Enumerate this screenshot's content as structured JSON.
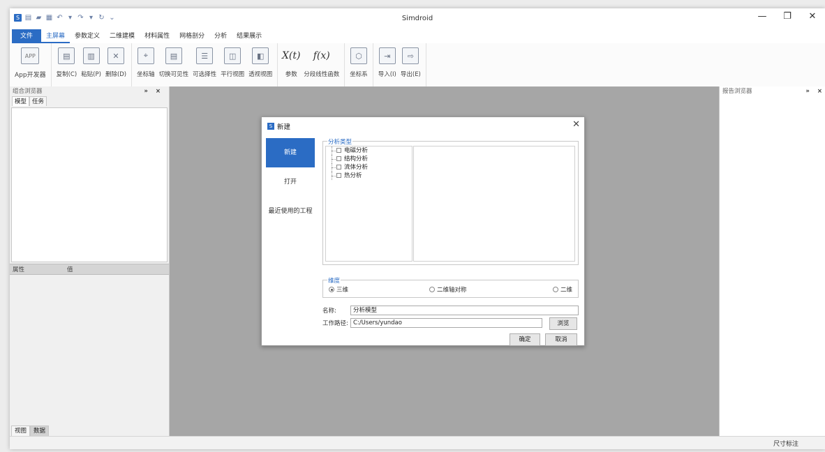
{
  "app": {
    "title": "Simdroid"
  },
  "window_controls": {
    "minimize": "—",
    "restore": "❐",
    "close": "✕"
  },
  "quick_access": [
    "save-icon",
    "open-folder-icon",
    "save-disk-icon",
    "undo-icon",
    "redo-icon",
    "refresh-icon"
  ],
  "menus": [
    "文件",
    "主屏幕",
    "参数定义",
    "二维建模",
    "材料属性",
    "网格剖分",
    "分析",
    "结果展示"
  ],
  "active_menu": "主屏幕",
  "ribbon": {
    "app_dev": {
      "icon": "APP",
      "label": "App开发器"
    },
    "copy": "复制(C)",
    "paste": "粘贴(P)",
    "delete": "删除(D)",
    "axis": "坐标轴",
    "toggle_visibility": "切换可见性",
    "selectability": "可选择性",
    "parallel_view": "平行视图",
    "perspective_view": "透视视图",
    "param_icon": "X(t)",
    "param": "参数",
    "piecewise_icon": "f(x)",
    "piecewise": "分段线性函数",
    "coord_system": "坐标系",
    "import": "导入(I)",
    "export": "导出(E)"
  },
  "left_panel": {
    "title": "组合浏览器",
    "tabs": [
      "模型",
      "任务"
    ],
    "prop_headers": {
      "property": "属性",
      "value": "值"
    },
    "bottom_tabs": [
      "视图",
      "数据"
    ]
  },
  "right_panel": {
    "title": "报告浏览器"
  },
  "status_bar": {
    "text": "尺寸标注"
  },
  "dialog": {
    "title": "新建",
    "nav": [
      "新建",
      "打开",
      "最近使用的工程"
    ],
    "analysis_type": {
      "legend": "分析类型",
      "items": [
        "电磁分析",
        "结构分析",
        "流体分析",
        "热分析"
      ]
    },
    "dimension": {
      "legend": "维度",
      "options": [
        "三维",
        "二维轴对称",
        "二维"
      ],
      "selected": "三维"
    },
    "name_label": "名称:",
    "name_value": "分析模型",
    "path_label": "工作路径:",
    "path_value": "C:/Users/yundao",
    "browse": "浏览",
    "ok": "确定",
    "cancel": "取消"
  }
}
